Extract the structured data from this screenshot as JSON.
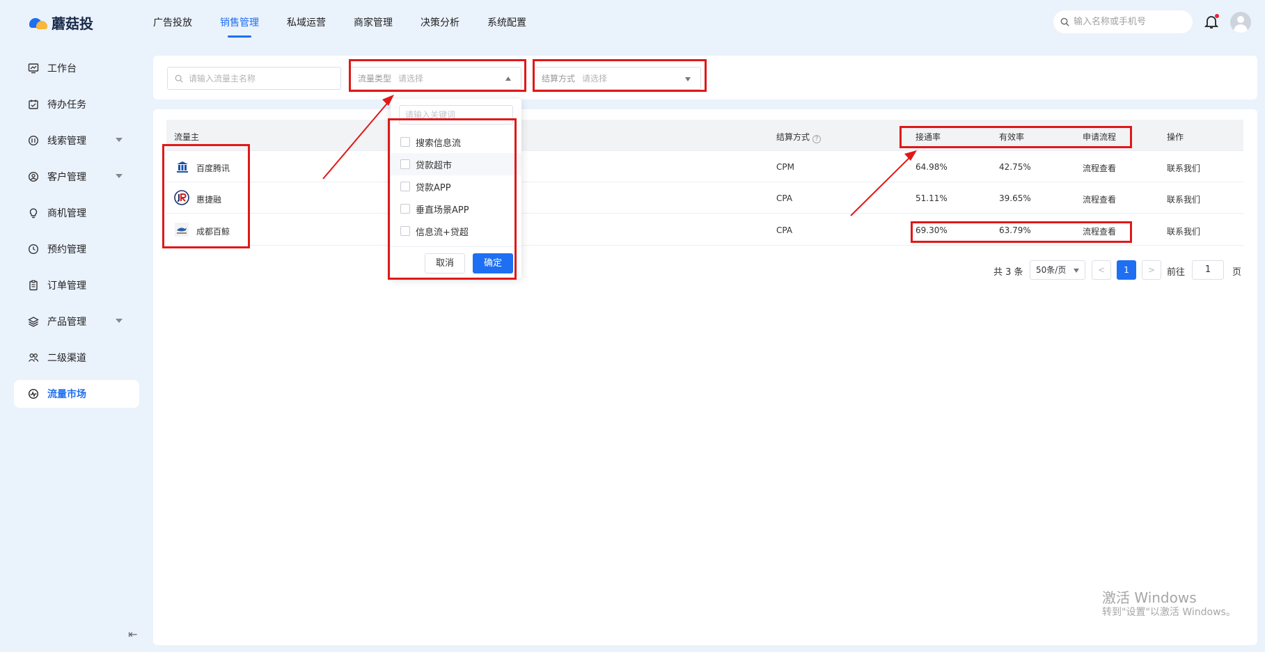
{
  "app": {
    "name": "蘑菇投"
  },
  "topnav": [
    "广告投放",
    "销售管理",
    "私域运营",
    "商家管理",
    "决策分析",
    "系统配置"
  ],
  "top_search": {
    "placeholder": "输入名称或手机号"
  },
  "sidebar": {
    "items": [
      {
        "label": "工作台",
        "icon": "dashboard-icon"
      },
      {
        "label": "待办任务",
        "icon": "calendar-check-icon"
      },
      {
        "label": "线索管理",
        "icon": "clue-icon",
        "expandable": true
      },
      {
        "label": "客户管理",
        "icon": "user-circle-icon",
        "expandable": true
      },
      {
        "label": "商机管理",
        "icon": "lightbulb-icon"
      },
      {
        "label": "预约管理",
        "icon": "clock-icon"
      },
      {
        "label": "订单管理",
        "icon": "clipboard-icon"
      },
      {
        "label": "产品管理",
        "icon": "layers-icon",
        "expandable": true
      },
      {
        "label": "二级渠道",
        "icon": "users-icon"
      },
      {
        "label": "流量市场",
        "icon": "pulse-icon",
        "active": true
      }
    ]
  },
  "filters": {
    "name_placeholder": "请输入流量主名称",
    "traffic_type_label": "流量类型",
    "traffic_type_placeholder": "请选择",
    "settlement_label": "结算方式",
    "settlement_placeholder": "请选择"
  },
  "dropdown": {
    "keyword_placeholder": "请输入关键词",
    "options": [
      "搜索信息流",
      "贷款超市",
      "贷款APP",
      "垂直场景APP",
      "信息流+贷超"
    ],
    "cancel": "取消",
    "confirm": "确定"
  },
  "table": {
    "headers": {
      "owner": "流量主",
      "settlement": "结算方式",
      "connect_rate": "接通率",
      "valid_rate": "有效率",
      "apply_flow": "申请流程",
      "action": "操作"
    },
    "rows": [
      {
        "owner": "百度腾讯",
        "settlement": "CPM",
        "connect_rate": "64.98%",
        "valid_rate": "42.75%",
        "apply_flow": "流程查看",
        "action": "联系我们"
      },
      {
        "owner": "惠捷融",
        "settlement": "CPA",
        "connect_rate": "51.11%",
        "valid_rate": "39.65%",
        "apply_flow": "流程查看",
        "action": "联系我们"
      },
      {
        "owner": "成都百鲸",
        "settlement": "CPA",
        "connect_rate": "69.30%",
        "valid_rate": "63.79%",
        "apply_flow": "流程查看",
        "action": "联系我们"
      }
    ]
  },
  "pagination": {
    "total": "共 3 条",
    "page_size": "50条/页",
    "prev": "<",
    "current": "1",
    "next": ">",
    "goto_label": "前往",
    "goto_value": "1",
    "goto_suffix": "页"
  },
  "watermark": {
    "line1": "激活 Windows",
    "line2": "转到\"设置\"以激活 Windows。"
  },
  "colors": {
    "accent": "#1e6ff2",
    "annotation_red": "#e01818",
    "page_bg": "#eaf2fc"
  }
}
